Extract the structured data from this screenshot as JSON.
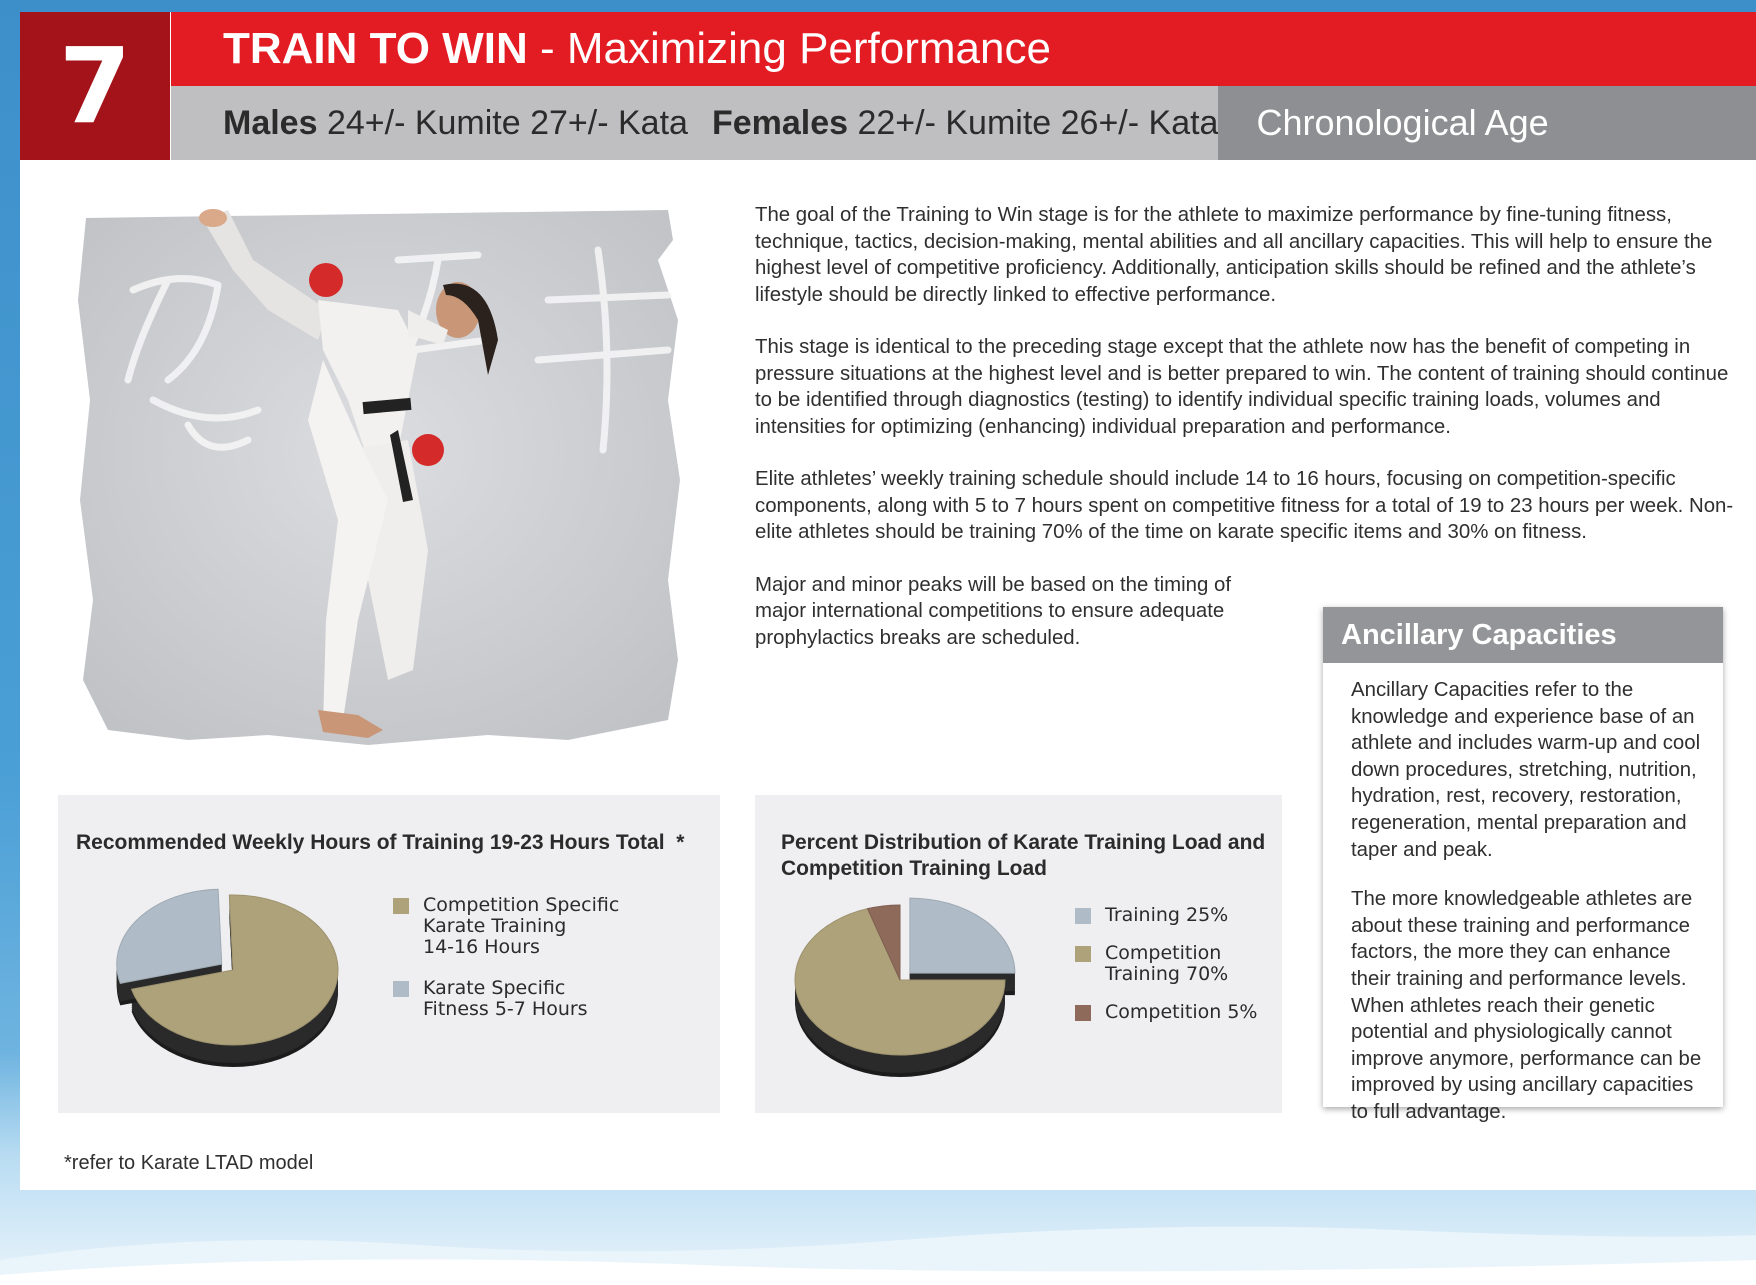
{
  "header": {
    "stage_number": "7",
    "title_strong": "TRAIN TO WIN",
    "title_rest": " - Maximizing Performance",
    "males_label": "Males",
    "males_text": " 24+/- Kumite 27+/- Kata",
    "females_label": "Females",
    "females_text": " 22+/- Kumite 26+/- Kata",
    "age_label": "Chronological Age"
  },
  "photo": {
    "icon": "karate-kick-photo"
  },
  "body": {
    "paragraphs": [
      "The goal of the Training to Win stage is for the athlete to maximize performance by fine-tuning fitness, technique, tactics, decision-making, mental abilities and all ancillary capacities.  This will help to ensure the highest level of competitive proficiency.  Additionally, anticipation skills should be refined and the athlete’s lifestyle should be directly linked to effective performance.",
      "This stage is identical to the preceding stage except that the athlete now has the benefit of competing in pressure situations at the highest level and is better prepared to win. The content of training should continue to be identified through diagnostics (testing) to identify individual specific training loads, volumes and intensities for optimizing (enhancing) individual preparation and performance.",
      "Elite athletes’ weekly training schedule should include 14 to 16 hours, focusing on competition-specific components, along with 5 to 7 hours spent on competitive fitness for a total of 19 to 23 hours per week. Non-elite athletes should be training 70% of the time on karate specific items and 30% on fitness.",
      "Major and minor peaks will be based on the timing of major international competitions to ensure adequate prophylactics breaks are scheduled."
    ]
  },
  "sidebar": {
    "title": "Ancillary Capacities",
    "paragraphs": [
      "Ancillary Capacities refer to the knowledge and experience base of an athlete and includes warm-up and cool down procedures, stretching, nutrition, hydration, rest, recovery, restoration, regeneration, mental preparation and taper and peak.",
      "The more knowledgeable athletes are about these training and performance factors, the more they can enhance their training and performance levels. When athletes reach their genetic potential and physiologically cannot improve anymore, performance can be improved by using ancillary capacities to full advantage."
    ]
  },
  "chart_data": [
    {
      "type": "pie",
      "title": "Recommended Weekly Hours of Training 19-23 Hours Total  *",
      "categories": [
        "Competition Specific Karate Training 14-16 Hours",
        "Karate Specific Fitness 5-7 Hours"
      ],
      "legend_lines": [
        [
          "Competition Specific",
          "Karate Training",
          "14-16 Hours"
        ],
        [
          "Karate Specific",
          "Fitness 5-7 Hours"
        ]
      ],
      "values": [
        15,
        6
      ],
      "colors": [
        "#aea27a",
        "#afbcc7"
      ],
      "exploded": [
        false,
        true
      ],
      "legend": "right"
    },
    {
      "type": "pie",
      "title": "Percent Distribution of Karate Training Load and Competition Training Load",
      "categories": [
        "Training 25%",
        "Competition Training 70%",
        "Competition 5%"
      ],
      "legend_lines": [
        [
          "Training 25%"
        ],
        [
          "Competition",
          "Training 70%"
        ],
        [
          "Competition 5%"
        ]
      ],
      "values": [
        25,
        70,
        5
      ],
      "colors": [
        "#afbcc7",
        "#aea27a",
        "#8e6a5b"
      ],
      "exploded": [
        true,
        false,
        false
      ],
      "legend": "right"
    }
  ],
  "footnote": "*refer to Karate LTAD model"
}
